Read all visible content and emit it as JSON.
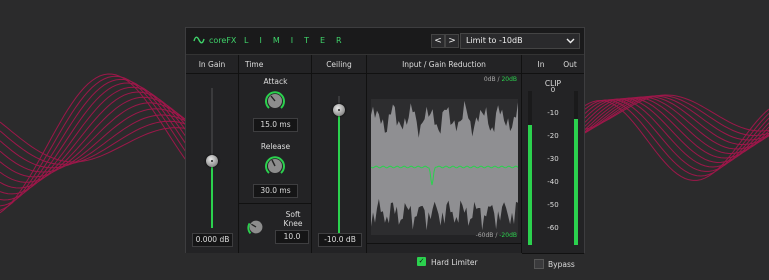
{
  "header": {
    "brand": "coreFX",
    "product": "LIMITER",
    "nav_prev": "<",
    "nav_next": ">",
    "preset": "Limit to -10dB"
  },
  "in_gain": {
    "title": "In Gain",
    "value": "0.000 dB",
    "level": 0.48
  },
  "time": {
    "title": "Time",
    "attack_label": "Attack",
    "attack_value": "15.0 ms",
    "release_label": "Release",
    "release_value": "30.0 ms",
    "soft_knee_label": "Soft Knee",
    "soft_knee_value": "10.0"
  },
  "ceiling": {
    "title": "Ceiling",
    "value": "-10.0 dB",
    "level": 0.9
  },
  "graph": {
    "title": "Input / Gain Reduction",
    "top_db_white": "0dB",
    "top_sep": "/",
    "top_db_green": "20dB",
    "bottom_db_white": "-60dB",
    "bottom_sep": "/",
    "bottom_db_green": "-20dB",
    "hard_limiter_label": "Hard Limiter",
    "hard_limiter_checked": true
  },
  "meters": {
    "in_label": "In",
    "out_label": "Out",
    "clip_label": "CLIP",
    "scale": [
      "0",
      "-10",
      "-20",
      "-30",
      "-40",
      "-50",
      "-60"
    ],
    "bypass_label": "Bypass",
    "in_level": 0.78,
    "out_level": 0.82
  },
  "colors": {
    "accent": "#2bd14e",
    "waves": "#b0144f"
  }
}
